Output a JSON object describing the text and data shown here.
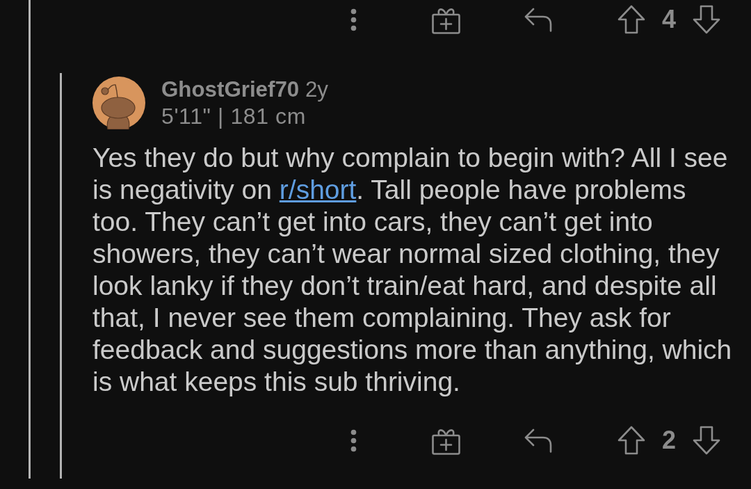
{
  "parent_comment_actions": {
    "vote_count": "4"
  },
  "reply": {
    "author": "GhostGrief70",
    "age": "2y",
    "flair": "5'11\" | 181 cm",
    "body": [
      {
        "kind": "text",
        "text": "Yes they do but why complain to begin with? All I see is negativity on "
      },
      {
        "kind": "link",
        "text": "r/short"
      },
      {
        "kind": "text",
        "text": ". Tall people have problems too. They can’t get into cars, they can’t get into showers, they can’t wear normal sized clothing, they look lanky if they don’t train/eat hard, and despite all that, I never see them complaining. They ask for feedback and suggestions more than anything, which is what keeps this sub thriving."
      }
    ],
    "actions": {
      "vote_count": "2"
    }
  }
}
